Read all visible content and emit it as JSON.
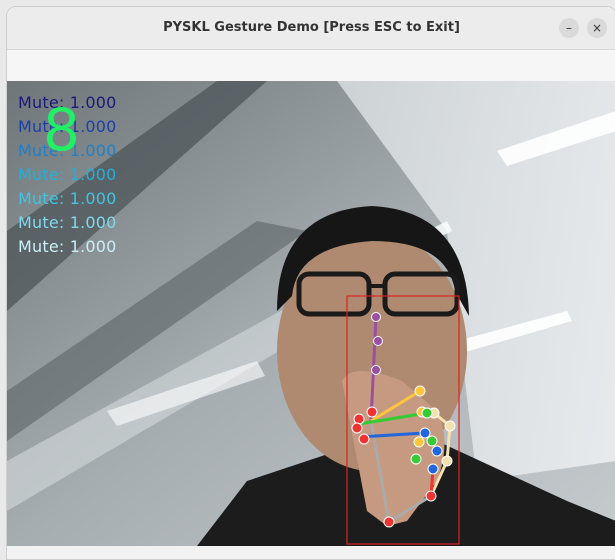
{
  "window": {
    "title": "PYSKL Gesture Demo [Press ESC to Exit]",
    "minimize_glyph": "–",
    "close_glyph": "×"
  },
  "overlay": {
    "digit": "8",
    "digit_color": "#22ee66",
    "lines": [
      {
        "text": "Mute: 1.000",
        "color": "#1a1a7a"
      },
      {
        "text": "Mute: 1.000",
        "color": "#1c3fa8"
      },
      {
        "text": "Mute: 1.000",
        "color": "#1f7fc8"
      },
      {
        "text": "Mute: 1.000",
        "color": "#22b0d8"
      },
      {
        "text": "Mute: 1.000",
        "color": "#40c4e0"
      },
      {
        "text": "Mute: 1.000",
        "color": "#7fd8ec"
      },
      {
        "text": "Mute: 1.000",
        "color": "#c8eef6"
      }
    ]
  },
  "detection": {
    "box_color": "#dd2222",
    "keypoint_colors": {
      "wrist": "#ee3333",
      "thumb": "#f5e0b0",
      "index": "#9b4fa0",
      "middle": "#ffc53d",
      "ring": "#33cc33",
      "pinky": "#2266dd",
      "base": "#ee3333"
    }
  }
}
